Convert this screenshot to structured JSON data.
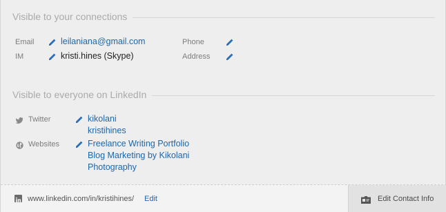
{
  "section_connections": {
    "title": "Visible to your connections"
  },
  "email": {
    "label": "Email",
    "value": "leilaniana@gmail.com"
  },
  "im": {
    "label": "IM",
    "value": "kristi.hines (Skype)"
  },
  "phone": {
    "label": "Phone",
    "value": ""
  },
  "address": {
    "label": "Address",
    "value": ""
  },
  "section_everyone": {
    "title": "Visible to everyone on LinkedIn"
  },
  "twitter": {
    "label": "Twitter",
    "handles": [
      "kikolani",
      "kristihines"
    ]
  },
  "websites": {
    "label": "Websites",
    "links": [
      "Freelance Writing Portfolio",
      "Blog Marketing by Kikolani",
      "Photography"
    ]
  },
  "footer": {
    "profile_url": "www.linkedin.com/in/kristihines/",
    "edit_label": "Edit",
    "edit_contact_label": "Edit Contact Info"
  },
  "colors": {
    "link": "#1b66ad",
    "pencil": "#2a6ebb",
    "muted": "#aaaaaa"
  },
  "icons": [
    "pencil-icon",
    "twitter-bird-icon",
    "globe-icon",
    "linkedin-icon",
    "contact-card-icon"
  ]
}
